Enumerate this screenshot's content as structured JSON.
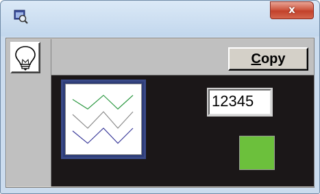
{
  "window": {
    "icon": "magnifier-window-icon",
    "close_label": "x"
  },
  "toolbar": {
    "bulb_icon": "lightbulb-icon",
    "copy_label_prefix": "",
    "copy_label_mnemonic": "C",
    "copy_label_rest": "opy"
  },
  "canvas": {
    "number_value": "12345",
    "swatch_color": "#6cc03c",
    "preview_line_colors": [
      "#2f9a44",
      "#8b8b8b",
      "#3a3a9a"
    ]
  }
}
